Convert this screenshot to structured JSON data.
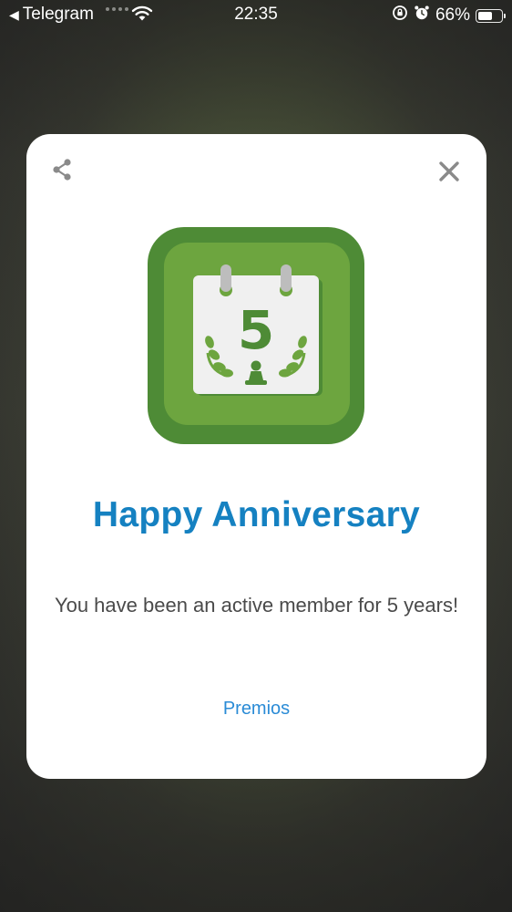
{
  "status_bar": {
    "back_app": "Telegram",
    "time": "22:35",
    "battery_percent": "66%",
    "battery_level": 0.66,
    "icons": [
      "back-arrow-icon",
      "signal-dots-icon",
      "wifi-icon",
      "orientation-lock-icon",
      "alarm-icon",
      "battery-icon"
    ]
  },
  "dialog": {
    "title": "Happy Anniversary",
    "message": "You have been an active member for 5 years!",
    "link_label": "Premios",
    "badge_number": "5",
    "share_icon": "share-icon",
    "close_icon": "close-icon",
    "badge_icon": "anniversary-calendar-icon"
  },
  "colors": {
    "title": "#1581c1",
    "link": "#2a8bd6",
    "message": "#4a4a4a",
    "badge_dark_green": "#4e8b36",
    "badge_light_green": "#6da53f",
    "calendar_number": "#4e8b36"
  }
}
